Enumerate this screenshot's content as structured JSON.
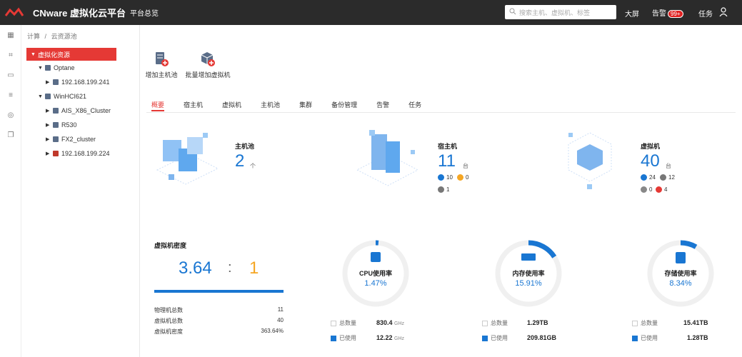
{
  "header": {
    "brand": "CNware 虚拟化云平台",
    "subtitle": "平台总览",
    "search_placeholder": "搜索主机、虚拟机、标签",
    "big_screen": "大屏",
    "alarm": "告警",
    "alarm_count": "99+",
    "tasks": "任务"
  },
  "breadcrumb": {
    "part1": "计算",
    "sep": "/",
    "part2": "云资源池"
  },
  "tree": {
    "root": "虚拟化资源",
    "nodes": [
      {
        "label": "Optane"
      },
      {
        "label": "192.168.199.241"
      },
      {
        "label": "WinHCI621"
      },
      {
        "label": "AIS_X86_Cluster"
      },
      {
        "label": "R530"
      },
      {
        "label": "FX2_cluster"
      },
      {
        "label": "192.168.199.224"
      }
    ]
  },
  "toolbar": {
    "add_pool": "增加主机池",
    "batch_add_vm": "批量增加虚拟机"
  },
  "tabs": [
    "概要",
    "宿主机",
    "虚拟机",
    "主机池",
    "集群",
    "备份管理",
    "告警",
    "任务"
  ],
  "summary": {
    "pool": {
      "title": "主机池",
      "count": "2",
      "unit": "个"
    },
    "host": {
      "title": "宿主机",
      "count": "11",
      "unit": "台",
      "running": "10",
      "warning": "0",
      "offline": "1"
    },
    "vm": {
      "title": "虚拟机",
      "count": "40",
      "unit": "台",
      "running": "24",
      "stopped": "12",
      "paused": "0",
      "error": "4"
    }
  },
  "density": {
    "title": "虚拟机密度",
    "left": "3.64",
    "colon": ":",
    "right": "1",
    "rows": [
      {
        "label": "物理机总数",
        "value": "11"
      },
      {
        "label": "虚拟机总数",
        "value": "40"
      },
      {
        "label": "虚拟机密度",
        "value": "363.64%"
      }
    ]
  },
  "gauges": [
    {
      "label": "CPU使用率",
      "value": "1.47%",
      "fraction": 0.0147,
      "total_label": "总数量",
      "total": "830.4",
      "total_unit": "GHz",
      "used_label": "已使用",
      "used": "12.22",
      "used_unit": "GHz"
    },
    {
      "label": "内存使用率",
      "value": "15.91%",
      "fraction": 0.1591,
      "total_label": "总数量",
      "total": "1.29TB",
      "total_unit": "",
      "used_label": "已使用",
      "used": "209.81GB",
      "used_unit": ""
    },
    {
      "label": "存储使用率",
      "value": "8.34%",
      "fraction": 0.0834,
      "total_label": "总数量",
      "total": "15.41TB",
      "total_unit": "",
      "used_label": "已使用",
      "used": "1.28TB",
      "used_unit": ""
    }
  ],
  "colors": {
    "accent": "#e53935",
    "primary": "#1976d2",
    "orange": "#f5a623",
    "gauge_track": "#f0f0f0"
  }
}
